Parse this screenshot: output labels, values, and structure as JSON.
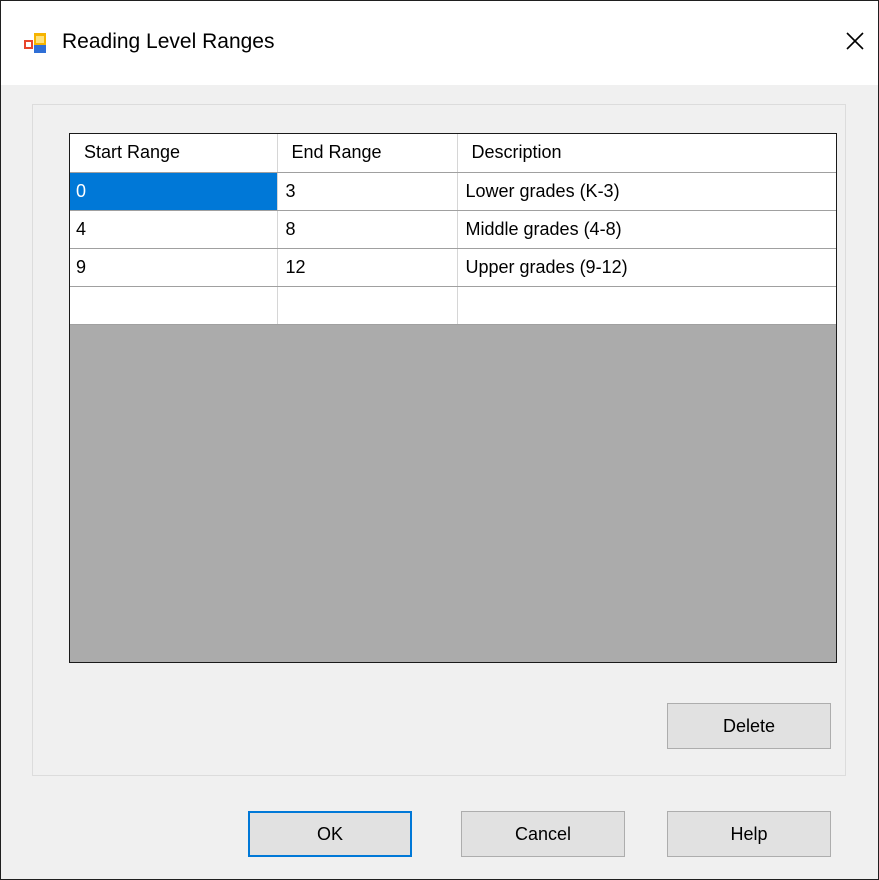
{
  "window": {
    "title": "Reading Level Ranges",
    "icon": "app-window-icon",
    "close_icon": "close-icon"
  },
  "grid": {
    "columns": [
      "Start Range",
      "End Range",
      "Description"
    ],
    "rows": [
      [
        "0",
        "3",
        "Lower grades (K-3)"
      ],
      [
        "4",
        "8",
        "Middle grades (4-8)"
      ],
      [
        "9",
        "12",
        "Upper grades (9-12)"
      ],
      [
        "",
        "",
        ""
      ]
    ],
    "selected_cell": "0,0"
  },
  "buttons": {
    "delete": "Delete",
    "ok": "OK",
    "cancel": "Cancel",
    "help": "Help"
  },
  "colors": {
    "selection": "#0078d7",
    "grid_background": "#ababab",
    "dialog_background": "#f0f0f0"
  }
}
